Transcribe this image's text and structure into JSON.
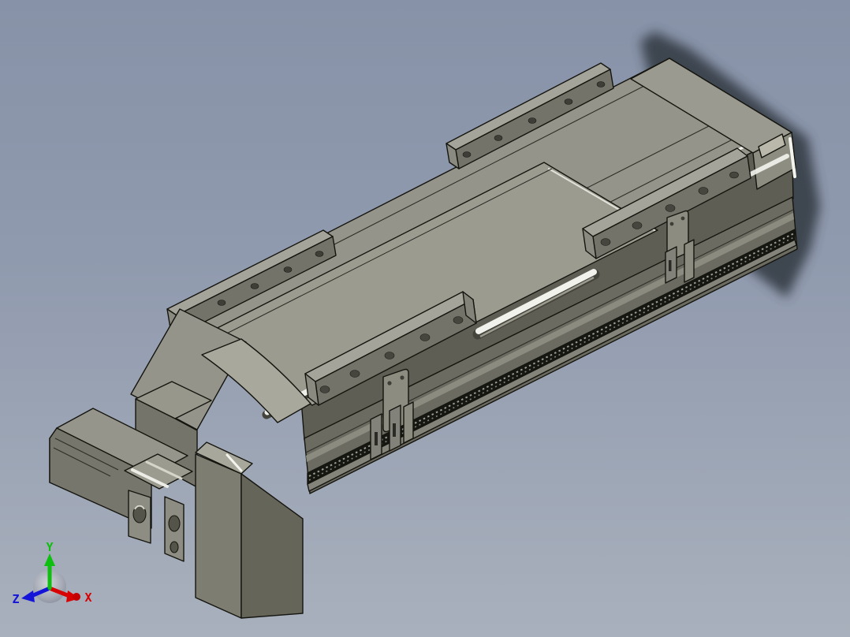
{
  "viewport": {
    "type": "cad-3d-shaded-viewport",
    "background_top_color": "#8792A8",
    "background_bottom_color": "#A9B0BD",
    "edge_line_color": "#15150f",
    "shadow_color": "#394049"
  },
  "model": {
    "name": "linear-actuator-module",
    "body_top_color": "#95948A",
    "body_side_color": "#6B6B61",
    "recess_color": "#5E5E54",
    "carriage_color": "#9C9B90",
    "bracket_face_color": "#73736A",
    "highlight_color": "#F4F4EF",
    "components": [
      "rail-body",
      "end-cap-hump",
      "carriage-plate",
      "mounting-bracket-far-left",
      "mounting-bracket-far-right",
      "mounting-bracket-near-left",
      "mounting-bracket-near-right",
      "guide-shaft-cylinder",
      "toothed-rack-strip",
      "sensor-bracket-mid",
      "sensor-bracket-end",
      "motor-housing",
      "coupling",
      "gearbox-flange-tabs",
      "end-cover-block",
      "rear-mount-block",
      "cast-shadow"
    ]
  },
  "triad": {
    "axes": [
      {
        "label": "X",
        "color": "#D80000"
      },
      {
        "label": "Y",
        "color": "#0FBF0F"
      },
      {
        "label": "Z",
        "color": "#1414D8"
      }
    ]
  }
}
